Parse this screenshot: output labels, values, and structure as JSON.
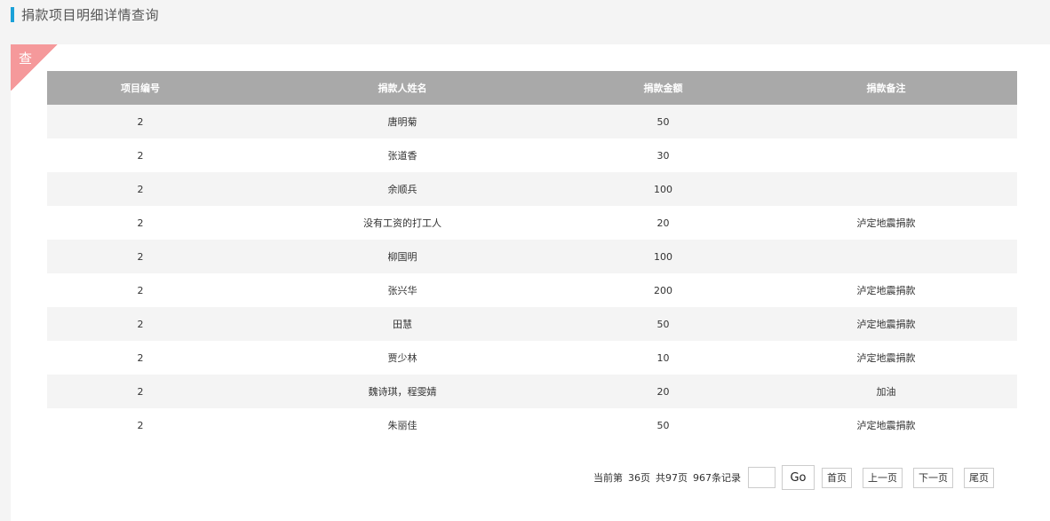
{
  "header": {
    "title": "捐款项目明细详情查询"
  },
  "panel": {
    "corner_label": "查"
  },
  "table": {
    "columns": [
      "项目编号",
      "捐款人姓名",
      "捐款金额",
      "捐款备注"
    ],
    "rows": [
      [
        "2",
        "唐明菊",
        "50",
        ""
      ],
      [
        "2",
        "张道香",
        "30",
        ""
      ],
      [
        "2",
        "余顺兵",
        "100",
        ""
      ],
      [
        "2",
        "没有工资的打工人",
        "20",
        "泸定地震捐款"
      ],
      [
        "2",
        "柳国明",
        "100",
        ""
      ],
      [
        "2",
        "张兴华",
        "200",
        "泸定地震捐款"
      ],
      [
        "2",
        "田慧",
        "50",
        "泸定地震捐款"
      ],
      [
        "2",
        "贾少林",
        "10",
        "泸定地震捐款"
      ],
      [
        "2",
        "魏诗琪，程雯婧",
        "20",
        "加油"
      ],
      [
        "2",
        "朱丽佳",
        "50",
        "泸定地震捐款"
      ]
    ]
  },
  "pager": {
    "current_label": "当前第",
    "current_page": "36页",
    "total_pages": "共97页",
    "total_records": "967条记录",
    "input_value": "",
    "go_label": "Go",
    "first_label": "首页",
    "prev_label": "上一页",
    "next_label": "下一页",
    "last_label": "尾页"
  }
}
